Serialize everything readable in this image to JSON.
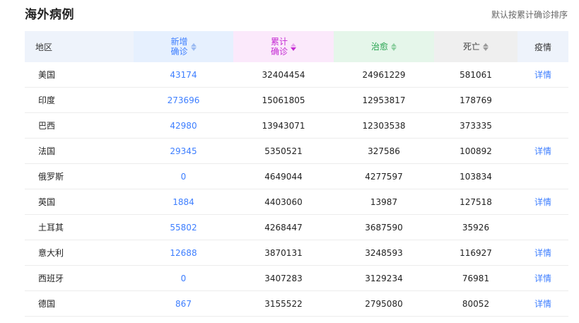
{
  "header": {
    "title": "海外病例",
    "sort_note": "默认按累计确诊排序"
  },
  "columns": {
    "region": "地区",
    "new_line1": "新增",
    "new_line2": "确诊",
    "total_line1": "累计",
    "total_line2": "确诊",
    "cured": "治愈",
    "dead": "死亡",
    "detail": "疫情"
  },
  "colors": {
    "new": "#3d7eff",
    "total": "#c42bd3",
    "cured": "#23a24d",
    "link": "#3d7eff"
  },
  "rows": [
    {
      "region": "美国",
      "new": "43174",
      "total": "32404454",
      "cured": "24961229",
      "dead": "581061",
      "detail": "详情"
    },
    {
      "region": "印度",
      "new": "273696",
      "total": "15061805",
      "cured": "12953817",
      "dead": "178769",
      "detail": ""
    },
    {
      "region": "巴西",
      "new": "42980",
      "total": "13943071",
      "cured": "12303538",
      "dead": "373335",
      "detail": ""
    },
    {
      "region": "法国",
      "new": "29345",
      "total": "5350521",
      "cured": "327586",
      "dead": "100892",
      "detail": "详情"
    },
    {
      "region": "俄罗斯",
      "new": "0",
      "total": "4649044",
      "cured": "4277597",
      "dead": "103834",
      "detail": ""
    },
    {
      "region": "英国",
      "new": "1884",
      "total": "4403060",
      "cured": "13987",
      "dead": "127518",
      "detail": "详情"
    },
    {
      "region": "土耳其",
      "new": "55802",
      "total": "4268447",
      "cured": "3687590",
      "dead": "35926",
      "detail": ""
    },
    {
      "region": "意大利",
      "new": "12688",
      "total": "3870131",
      "cured": "3248593",
      "dead": "116927",
      "detail": "详情"
    },
    {
      "region": "西班牙",
      "new": "0",
      "total": "3407283",
      "cured": "3129234",
      "dead": "76981",
      "detail": "详情"
    },
    {
      "region": "德国",
      "new": "867",
      "total": "3155522",
      "cured": "2795080",
      "dead": "80052",
      "detail": "详情"
    }
  ]
}
